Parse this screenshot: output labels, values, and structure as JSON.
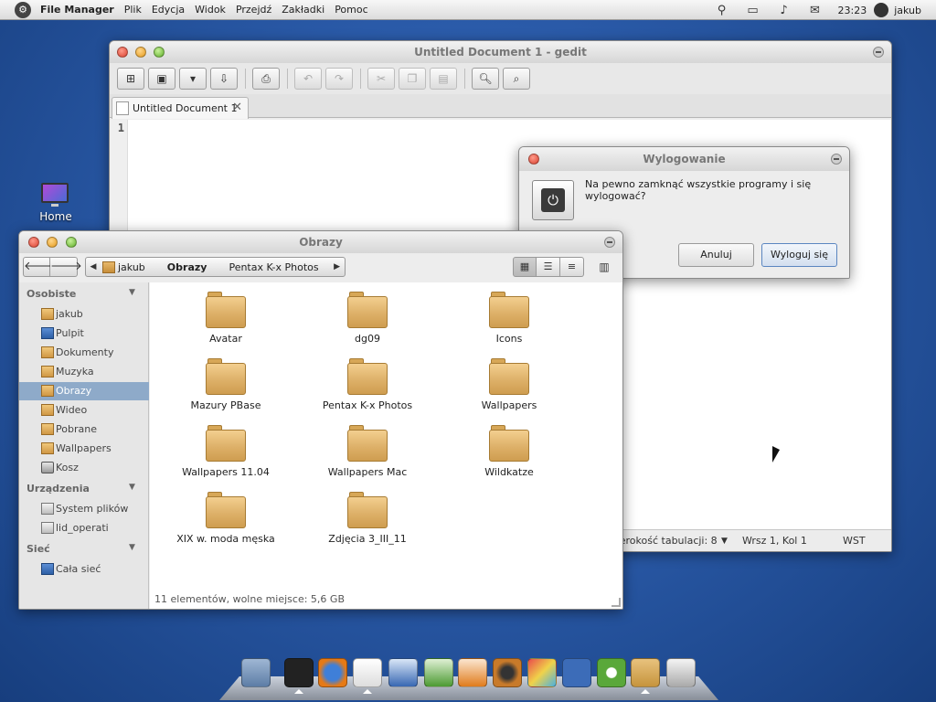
{
  "top_panel": {
    "app_name": "File Manager",
    "menus": [
      "Plik",
      "Edycja",
      "Widok",
      "Przejdź",
      "Zakładki",
      "Pomoc"
    ],
    "time": "23:23",
    "user": "jakub",
    "indicators": [
      "network-icon",
      "battery-icon",
      "volume-icon",
      "mail-icon"
    ]
  },
  "desktop": {
    "home_icon_label": "Home"
  },
  "gedit": {
    "title": "Untitled Document 1 - gedit",
    "tab_label": "Untitled Document 1",
    "line_number": "1",
    "status": {
      "tab_width": "Szerokość tabulacji:  8",
      "position": "Wrsz 1, Kol 1",
      "mode": "WST"
    }
  },
  "logout_dialog": {
    "title": "Wylogowanie",
    "message": "Na pewno zamknąć wszystkie programy i się wylogować?",
    "cancel_label": "Anuluj",
    "confirm_label": "Wyloguj się"
  },
  "file_manager": {
    "title": "Obrazy",
    "breadcrumbs": [
      "jakub",
      "Obrazy",
      "Pentax K-x Photos"
    ],
    "sidebar": {
      "personal_header": "Osobiste",
      "personal": [
        "jakub",
        "Pulpit",
        "Dokumenty",
        "Muzyka",
        "Obrazy",
        "Wideo",
        "Pobrane",
        "Wallpapers",
        "Kosz"
      ],
      "devices_header": "Urządzenia",
      "devices": [
        "System plików",
        "lid_operati"
      ],
      "network_header": "Sieć",
      "network": [
        "Cała sieć"
      ]
    },
    "folders": [
      "Avatar",
      "dg09",
      "Icons",
      "Mazury PBase",
      "Pentax K-x Photos",
      "Wallpapers",
      "Wallpapers 11.04",
      "Wallpapers Mac",
      "Wildkatze",
      "XIX w. moda męska",
      "Zdjęcia 3_III_11"
    ],
    "status": "11 elementów, wolne miejsce: 5,6 GB"
  },
  "dock": {
    "items": [
      "system-monitor-icon",
      "terminal-icon",
      "firefox-icon",
      "text-editor-icon",
      "writer-icon",
      "calc-icon",
      "impress-icon",
      "speaker-icon",
      "paint-icon",
      "gnome-icon",
      "update-manager-icon",
      "home-folder-icon",
      "trash-icon"
    ]
  }
}
